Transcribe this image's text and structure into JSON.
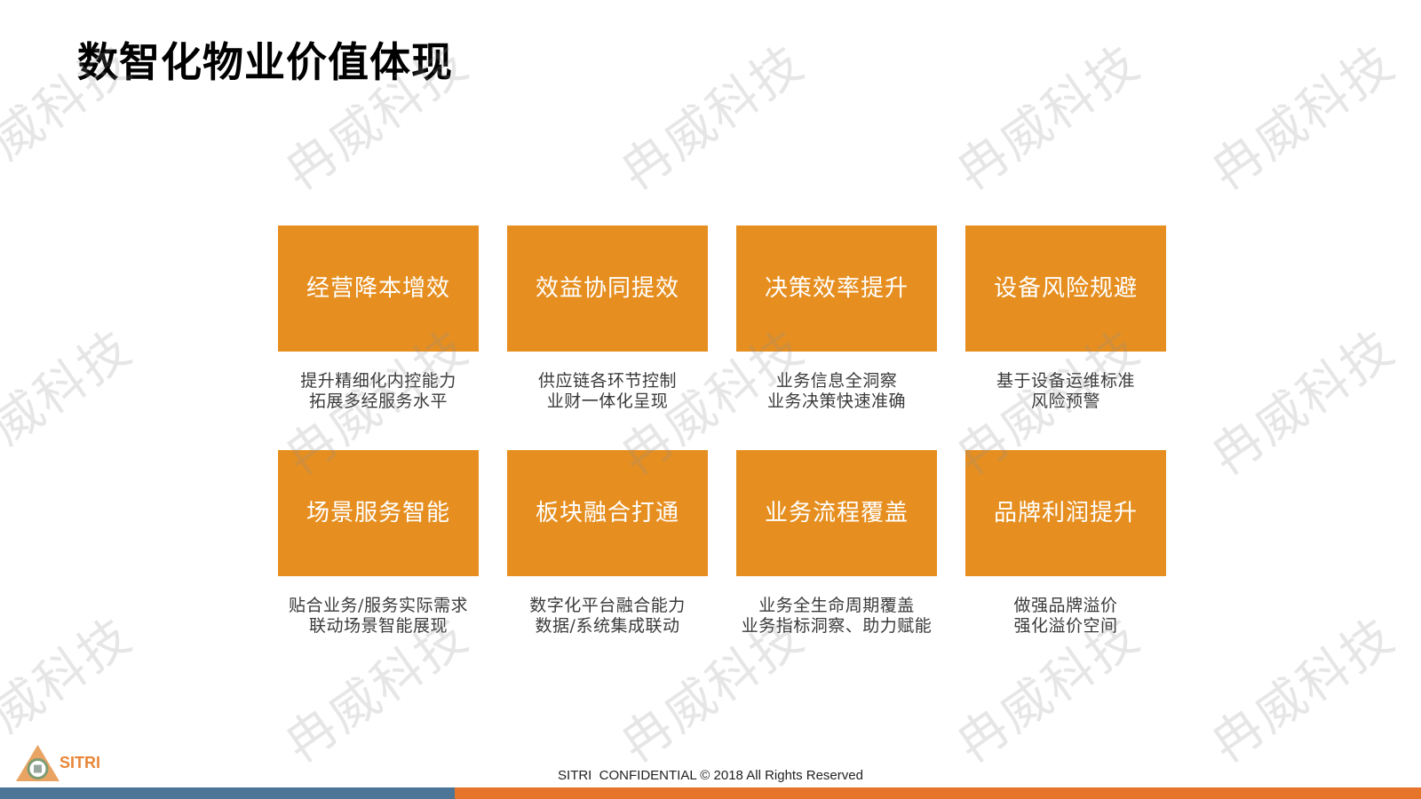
{
  "slide": {
    "title": "数智化物业价值体现",
    "cards": [
      {
        "label": "经营降本增效",
        "desc": [
          "提升精细化内控能力",
          "拓展多经服务水平"
        ]
      },
      {
        "label": "效益协同提效",
        "desc": [
          "供应链各环节控制",
          "业财一体化呈现"
        ]
      },
      {
        "label": "决策效率提升",
        "desc": [
          "业务信息全洞察",
          "业务决策快速准确"
        ]
      },
      {
        "label": "设备风险规避",
        "desc": [
          "基于设备运维标准",
          "风险预警"
        ]
      },
      {
        "label": "场景服务智能",
        "desc": [
          "贴合业务/服务实际需求",
          "联动场景智能展现"
        ]
      },
      {
        "label": "板块融合打通",
        "desc": [
          "数字化平台融合能力",
          "数据/系统集成联动"
        ]
      },
      {
        "label": "业务流程覆盖",
        "desc": [
          "业务全生命周期覆盖",
          "业务指标洞察、助力赋能"
        ]
      },
      {
        "label": "品牌利润提升",
        "desc": [
          "做强品牌溢价",
          "强化溢价空间"
        ]
      }
    ],
    "footer": "SITRI  CONFIDENTIAL © 2018 All Rights Reserved",
    "logo": {
      "text": "SITRI",
      "icon": "sitri-triangle-logo-icon"
    },
    "watermark": "冉威科技"
  },
  "colors": {
    "card": "#E68F20",
    "bar_left": "#4C7597",
    "bar_right": "#E7742B",
    "logo_text": "#E8873A",
    "logo_triangle": "#E9A463",
    "logo_ring": "#7E9C72"
  }
}
